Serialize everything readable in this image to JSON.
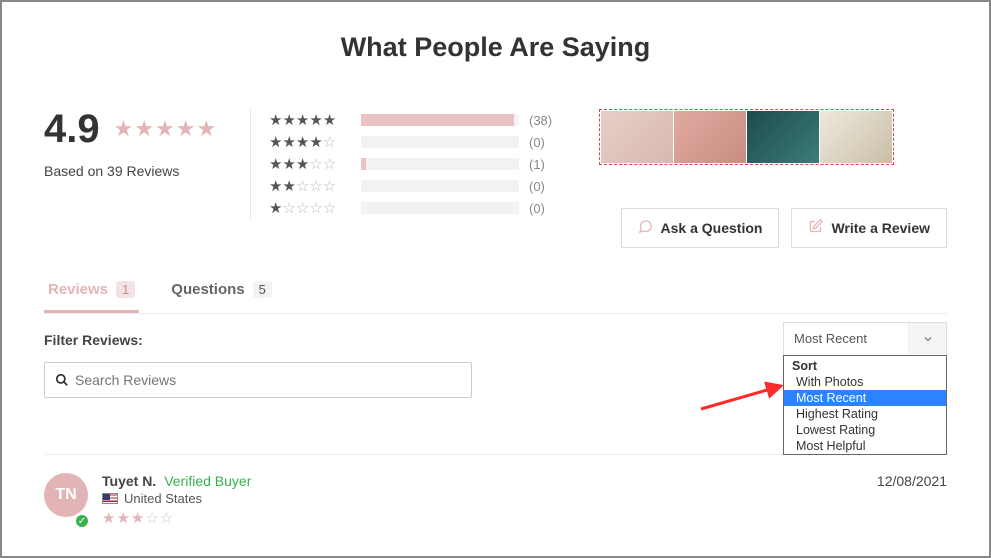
{
  "heading": "What People Are Saying",
  "overall": {
    "score": "4.9",
    "based_on": "Based on 39 Reviews"
  },
  "breakdown": [
    {
      "filled": 5,
      "count": "(38)",
      "pct": 97
    },
    {
      "filled": 4,
      "count": "(0)",
      "pct": 0
    },
    {
      "filled": 3,
      "count": "(1)",
      "pct": 3
    },
    {
      "filled": 2,
      "count": "(0)",
      "pct": 0
    },
    {
      "filled": 1,
      "count": "(0)",
      "pct": 0
    }
  ],
  "actions": {
    "ask": "Ask a Question",
    "write": "Write a Review"
  },
  "tabs": {
    "reviews_label": "Reviews",
    "reviews_count": "1",
    "questions_label": "Questions",
    "questions_count": "5"
  },
  "filter_label": "Filter Reviews:",
  "search": {
    "placeholder": "Search Reviews"
  },
  "sort": {
    "selected": "Most Recent",
    "header": "Sort",
    "options": [
      "With Photos",
      "Most Recent",
      "Highest Rating",
      "Lowest Rating",
      "Most Helpful"
    ],
    "highlighted": "Most Recent"
  },
  "review": {
    "initials": "TN",
    "name": "Tuyet N.",
    "verified": "Verified Buyer",
    "country": "United States",
    "date": "12/08/2021",
    "stars_filled": 3
  }
}
